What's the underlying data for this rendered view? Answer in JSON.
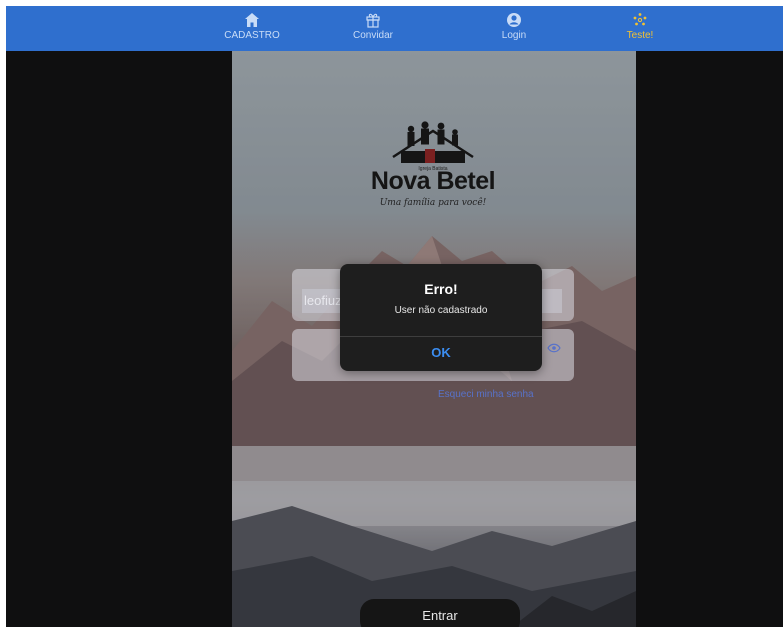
{
  "nav": {
    "items": [
      {
        "label": "CADASTRO",
        "icon": "home-icon"
      },
      {
        "label": "Convidar",
        "icon": "gift-icon"
      },
      {
        "label": "Login",
        "icon": "user-circle-icon"
      },
      {
        "label": "Teste!",
        "icon": "sparkle-icon"
      }
    ],
    "active_index": 3,
    "bar_color": "#2f6fce",
    "active_color": "#f3c232"
  },
  "logo": {
    "small_text": "Igreja Batista",
    "title": "Nova Betel",
    "tagline": "Uma família para você!"
  },
  "login": {
    "username_value": "leofiuza",
    "forgot_label": "Esqueci minha senha",
    "enter_label": "Entrar"
  },
  "alert": {
    "title": "Erro!",
    "message": "User não cadastrado",
    "ok_label": "OK",
    "ok_color": "#3b8df0"
  }
}
